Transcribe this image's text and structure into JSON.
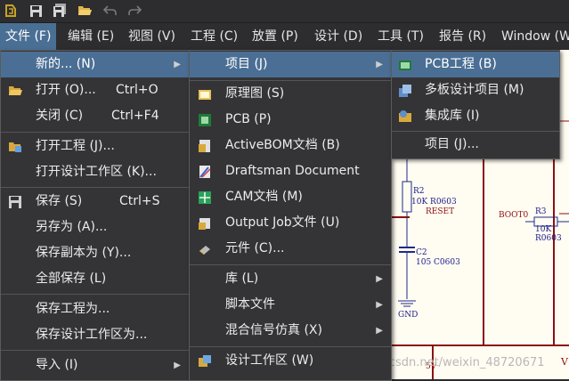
{
  "menubar": {
    "items": [
      {
        "label": "文件 (F)"
      },
      {
        "label": "编辑 (E)"
      },
      {
        "label": "视图 (V)"
      },
      {
        "label": "工程 (C)"
      },
      {
        "label": "放置 (P)"
      },
      {
        "label": "设计 (D)"
      },
      {
        "label": "工具 (T)"
      },
      {
        "label": "报告 (R)"
      },
      {
        "label": "Window (W"
      }
    ]
  },
  "file_menu": {
    "items": [
      {
        "label": "新的... (N)",
        "shortcut": ""
      },
      {
        "label": "打开 (O)...",
        "shortcut": "Ctrl+O"
      },
      {
        "label": "关闭 (C)",
        "shortcut": "Ctrl+F4"
      },
      {
        "label": "打开工程 (J)...",
        "shortcut": ""
      },
      {
        "label": "打开设计工作区 (K)...",
        "shortcut": ""
      },
      {
        "label": "保存 (S)",
        "shortcut": "Ctrl+S"
      },
      {
        "label": "另存为 (A)...",
        "shortcut": ""
      },
      {
        "label": "保存副本为 (Y)...",
        "shortcut": ""
      },
      {
        "label": "全部保存 (L)",
        "shortcut": ""
      },
      {
        "label": "保存工程为...",
        "shortcut": ""
      },
      {
        "label": "保存设计工作区为...",
        "shortcut": ""
      },
      {
        "label": "导入 (I)",
        "shortcut": ""
      }
    ]
  },
  "new_menu": {
    "items": [
      {
        "label": "项目 (J)"
      },
      {
        "label": "原理图 (S)"
      },
      {
        "label": "PCB (P)"
      },
      {
        "label": "ActiveBOM文档 (B)"
      },
      {
        "label": "Draftsman Document"
      },
      {
        "label": "CAM文档 (M)"
      },
      {
        "label": "Output Job文件 (U)"
      },
      {
        "label": "元件 (C)..."
      },
      {
        "label": "库 (L)"
      },
      {
        "label": "脚本文件"
      },
      {
        "label": "混合信号仿真 (X)"
      },
      {
        "label": "设计工作区 (W)"
      }
    ]
  },
  "project_menu": {
    "items": [
      {
        "label": "PCB工程 (B)"
      },
      {
        "label": "多板设计项目 (M)"
      },
      {
        "label": "集成库 (I)"
      },
      {
        "label": "项目 (J)..."
      }
    ]
  },
  "schematic": {
    "r2_ref": "R2",
    "r2_val": "10K R0603",
    "reset": "RESET",
    "c2_ref": "C2",
    "c2_val": "105 C0603",
    "gnd": "GND",
    "boot0": "BOOT0",
    "r3_ref": "R3",
    "r3_val": "10K R0603",
    "v5": "5V",
    "v_right": "V"
  },
  "watermark": "https://blog.csdn.net/weixin_48720671",
  "colors": {
    "menu_bg": "#343436",
    "highlight": "#4b6f94",
    "menubar_active": "#4a6f94",
    "schematic_bg": "#fffcf2",
    "schematic_wire": "#8b1010",
    "schematic_text": "#1a1a8a"
  }
}
